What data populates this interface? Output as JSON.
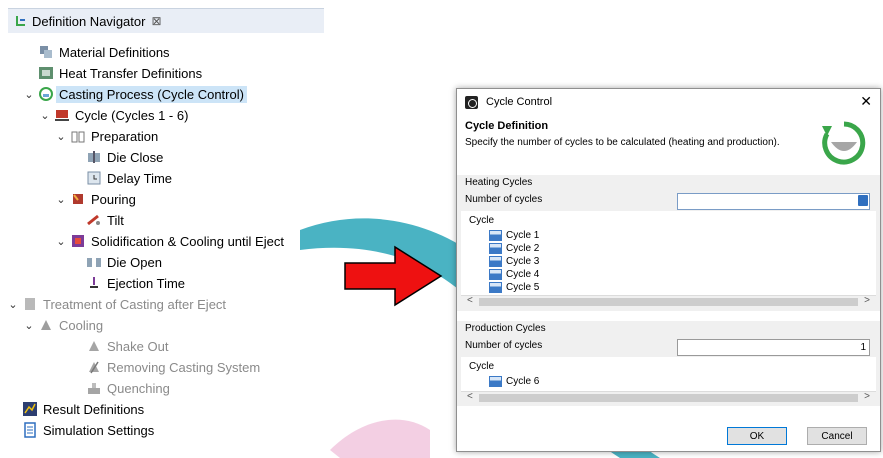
{
  "navigator": {
    "title": "Definition Navigator",
    "close_glyph": "⊠",
    "items": [
      {
        "label": "Material Definitions",
        "icon": "material-icon"
      },
      {
        "label": "Heat Transfer Definitions",
        "icon": "heat-transfer-icon"
      },
      {
        "label": "Casting Process (Cycle Control)",
        "icon": "cycle-control-icon",
        "selected": true
      },
      {
        "label": "Cycle (Cycles 1 - 6)",
        "icon": "cycle-icon"
      },
      {
        "label": "Preparation",
        "icon": "preparation-icon"
      },
      {
        "label": "Die Close",
        "icon": "die-close-icon"
      },
      {
        "label": "Delay Time",
        "icon": "delay-time-icon"
      },
      {
        "label": "Pouring",
        "icon": "pouring-icon"
      },
      {
        "label": "Tilt",
        "icon": "tilt-icon"
      },
      {
        "label": "Solidification & Cooling until Eject",
        "icon": "solidification-icon"
      },
      {
        "label": "Die Open",
        "icon": "die-open-icon"
      },
      {
        "label": "Ejection Time",
        "icon": "ejection-time-icon"
      },
      {
        "label": "Treatment of Casting after Eject",
        "icon": "treatment-icon",
        "disabled": true
      },
      {
        "label": "Cooling",
        "icon": "cooling-icon",
        "disabled": true
      },
      {
        "label": "Shake Out",
        "icon": "shake-out-icon",
        "disabled": true
      },
      {
        "label": "Removing Casting System",
        "icon": "removing-casting-icon",
        "disabled": true
      },
      {
        "label": "Quenching",
        "icon": "quenching-icon",
        "disabled": true
      },
      {
        "label": "Result Definitions",
        "icon": "result-definitions-icon"
      },
      {
        "label": "Simulation Settings",
        "icon": "simulation-settings-icon"
      }
    ]
  },
  "dialog": {
    "title": "Cycle Control",
    "close_glyph": "✕",
    "header_title": "Cycle Definition",
    "header_desc": "Specify the number of cycles to be calculated (heating and production).",
    "heating": {
      "section_label": "Heating Cycles",
      "num_label": "Number of cycles",
      "num_value": "",
      "cycle_header": "Cycle",
      "cycles": [
        "Cycle 1",
        "Cycle 2",
        "Cycle 3",
        "Cycle 4",
        "Cycle 5"
      ]
    },
    "production": {
      "section_label": "Production Cycles",
      "num_label": "Number of cycles",
      "num_value": "1",
      "cycle_header": "Cycle",
      "cycles": [
        "Cycle 6"
      ]
    },
    "ok_label": "OK",
    "cancel_label": "Cancel",
    "scroll_left": "<",
    "scroll_right": ">"
  },
  "colors": {
    "selection": "#cce4f7",
    "arrow_red": "#ee1111",
    "accent_green": "#3aa64a",
    "swirl_teal": "#2aa6b8"
  }
}
